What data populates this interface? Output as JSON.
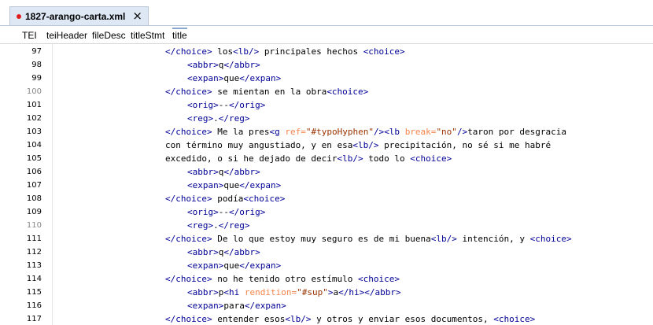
{
  "tab": {
    "title": "1827-arango-carta.xml",
    "close_glyph": "×",
    "modified_color": "#e02020"
  },
  "breadcrumb": [
    "TEI",
    "teiHeader",
    "fileDesc",
    "titleStmt",
    "title"
  ],
  "lines": [
    {
      "num": "97",
      "dim": false,
      "indent": 5,
      "tokens": [
        [
          "t",
          "</choice>"
        ],
        [
          "tx",
          " los"
        ],
        [
          "t",
          "<lb/>"
        ],
        [
          "tx",
          " principales hechos "
        ],
        [
          "t",
          "<choice>"
        ]
      ]
    },
    {
      "num": "98",
      "dim": false,
      "indent": 6,
      "tokens": [
        [
          "t",
          "<abbr>"
        ],
        [
          "tx",
          "q"
        ],
        [
          "t",
          "</abbr>"
        ]
      ]
    },
    {
      "num": "99",
      "dim": false,
      "indent": 6,
      "tokens": [
        [
          "t",
          "<expan>"
        ],
        [
          "tx",
          "que"
        ],
        [
          "t",
          "</expan>"
        ]
      ]
    },
    {
      "num": "100",
      "dim": true,
      "indent": 5,
      "tokens": [
        [
          "t",
          "</choice>"
        ],
        [
          "tx",
          " se mientan en la obra"
        ],
        [
          "t",
          "<choice>"
        ]
      ]
    },
    {
      "num": "101",
      "dim": false,
      "indent": 6,
      "tokens": [
        [
          "t",
          "<orig>"
        ],
        [
          "tx",
          "--"
        ],
        [
          "t",
          "</orig>"
        ]
      ]
    },
    {
      "num": "102",
      "dim": false,
      "indent": 6,
      "tokens": [
        [
          "t",
          "<reg>"
        ],
        [
          "tx",
          "."
        ],
        [
          "t",
          "</reg>"
        ]
      ]
    },
    {
      "num": "103",
      "dim": false,
      "indent": 5,
      "tokens": [
        [
          "t",
          "</choice>"
        ],
        [
          "tx",
          " Me la pres"
        ],
        [
          "t",
          "<g "
        ],
        [
          "an",
          "ref="
        ],
        [
          "av",
          "\"#typoHyphen\""
        ],
        [
          "t",
          "/>"
        ],
        [
          "t",
          "<lb "
        ],
        [
          "an",
          "break="
        ],
        [
          "av",
          "\"no\""
        ],
        [
          "t",
          "/>"
        ],
        [
          "tx",
          "taron por desgracia"
        ]
      ]
    },
    {
      "num": "104",
      "dim": false,
      "indent": 5,
      "tokens": [
        [
          "tx",
          "con término muy angustiado, y en esa"
        ],
        [
          "t",
          "<lb/>"
        ],
        [
          "tx",
          " precipitación, no sé si me habré"
        ]
      ]
    },
    {
      "num": "105",
      "dim": false,
      "indent": 5,
      "tokens": [
        [
          "tx",
          "excedido, o si he dejado de decir"
        ],
        [
          "t",
          "<lb/>"
        ],
        [
          "tx",
          " todo lo "
        ],
        [
          "t",
          "<choice>"
        ]
      ]
    },
    {
      "num": "106",
      "dim": false,
      "indent": 6,
      "tokens": [
        [
          "t",
          "<abbr>"
        ],
        [
          "tx",
          "q"
        ],
        [
          "t",
          "</abbr>"
        ]
      ]
    },
    {
      "num": "107",
      "dim": false,
      "indent": 6,
      "tokens": [
        [
          "t",
          "<expan>"
        ],
        [
          "tx",
          "que"
        ],
        [
          "t",
          "</expan>"
        ]
      ]
    },
    {
      "num": "108",
      "dim": false,
      "indent": 5,
      "tokens": [
        [
          "t",
          "</choice>"
        ],
        [
          "tx",
          " podía"
        ],
        [
          "t",
          "<choice>"
        ]
      ]
    },
    {
      "num": "109",
      "dim": false,
      "indent": 6,
      "tokens": [
        [
          "t",
          "<orig>"
        ],
        [
          "tx",
          "--"
        ],
        [
          "t",
          "</orig>"
        ]
      ]
    },
    {
      "num": "110",
      "dim": true,
      "indent": 6,
      "tokens": [
        [
          "t",
          "<reg>"
        ],
        [
          "tx",
          "."
        ],
        [
          "t",
          "</reg>"
        ]
      ]
    },
    {
      "num": "111",
      "dim": false,
      "indent": 5,
      "tokens": [
        [
          "t",
          "</choice>"
        ],
        [
          "tx",
          " De lo que estoy muy seguro es de mi buena"
        ],
        [
          "t",
          "<lb/>"
        ],
        [
          "tx",
          " intención, y "
        ],
        [
          "t",
          "<choice>"
        ]
      ]
    },
    {
      "num": "112",
      "dim": false,
      "indent": 6,
      "tokens": [
        [
          "t",
          "<abbr>"
        ],
        [
          "tx",
          "q"
        ],
        [
          "t",
          "</abbr>"
        ]
      ]
    },
    {
      "num": "113",
      "dim": false,
      "indent": 6,
      "tokens": [
        [
          "t",
          "<expan>"
        ],
        [
          "tx",
          "que"
        ],
        [
          "t",
          "</expan>"
        ]
      ]
    },
    {
      "num": "114",
      "dim": false,
      "indent": 5,
      "tokens": [
        [
          "t",
          "</choice>"
        ],
        [
          "tx",
          " no he tenido otro estímulo "
        ],
        [
          "t",
          "<choice>"
        ]
      ]
    },
    {
      "num": "115",
      "dim": false,
      "indent": 6,
      "tokens": [
        [
          "t",
          "<abbr>"
        ],
        [
          "tx",
          "p"
        ],
        [
          "t",
          "<hi "
        ],
        [
          "an",
          "rendition="
        ],
        [
          "av",
          "\"#sup\""
        ],
        [
          "t",
          ">"
        ],
        [
          "tx",
          "a"
        ],
        [
          "t",
          "</hi>"
        ],
        [
          "t",
          "</abbr>"
        ]
      ]
    },
    {
      "num": "116",
      "dim": false,
      "indent": 6,
      "tokens": [
        [
          "t",
          "<expan>"
        ],
        [
          "tx",
          "para"
        ],
        [
          "t",
          "</expan>"
        ]
      ]
    },
    {
      "num": "117",
      "dim": false,
      "indent": 5,
      "tokens": [
        [
          "t",
          "</choice>"
        ],
        [
          "tx",
          " entender esos"
        ],
        [
          "t",
          "<lb/>"
        ],
        [
          "tx",
          " y otros y enviar esos documentos, "
        ],
        [
          "t",
          "<choice>"
        ]
      ]
    }
  ],
  "colors": {
    "tag": "#000096",
    "attr_name": "#f5844c",
    "attr_value": "#993300",
    "text": "#000000"
  }
}
